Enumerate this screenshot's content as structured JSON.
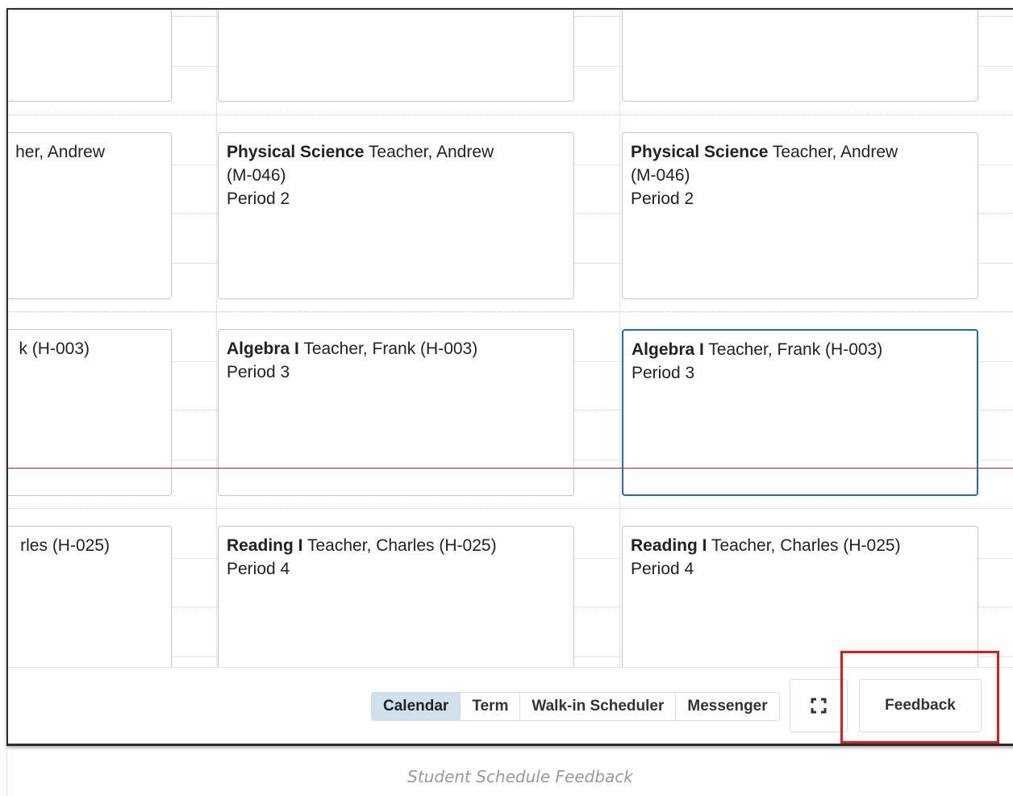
{
  "events": {
    "period2": {
      "course": "Physical Science",
      "teacher": " Teacher, Andrew",
      "room": "(M-046)",
      "period": "Period 2",
      "clipped_text": "her, Andrew"
    },
    "period3": {
      "course": "Algebra I",
      "teacher": " Teacher, Frank (H-003)",
      "period": "Period 3",
      "clipped_text": "k (H-003)"
    },
    "period4": {
      "course": "Reading I",
      "teacher": " Teacher, Charles (H-025)",
      "period": "Period 4",
      "clipped_text": "rles (H-025)"
    }
  },
  "toolbar": {
    "tabs": [
      "Calendar",
      "Term",
      "Walk-in Scheduler",
      "Messenger"
    ],
    "active_tab": "Calendar",
    "expand_icon": "fullscreen-icon",
    "feedback_label": "Feedback"
  },
  "caption": "Student Schedule Feedback",
  "colors": {
    "selected_border": "#1f6fb2",
    "active_tab": "#cfe0ef",
    "now_line": "#e02020",
    "highlight": "#e01a1a"
  }
}
